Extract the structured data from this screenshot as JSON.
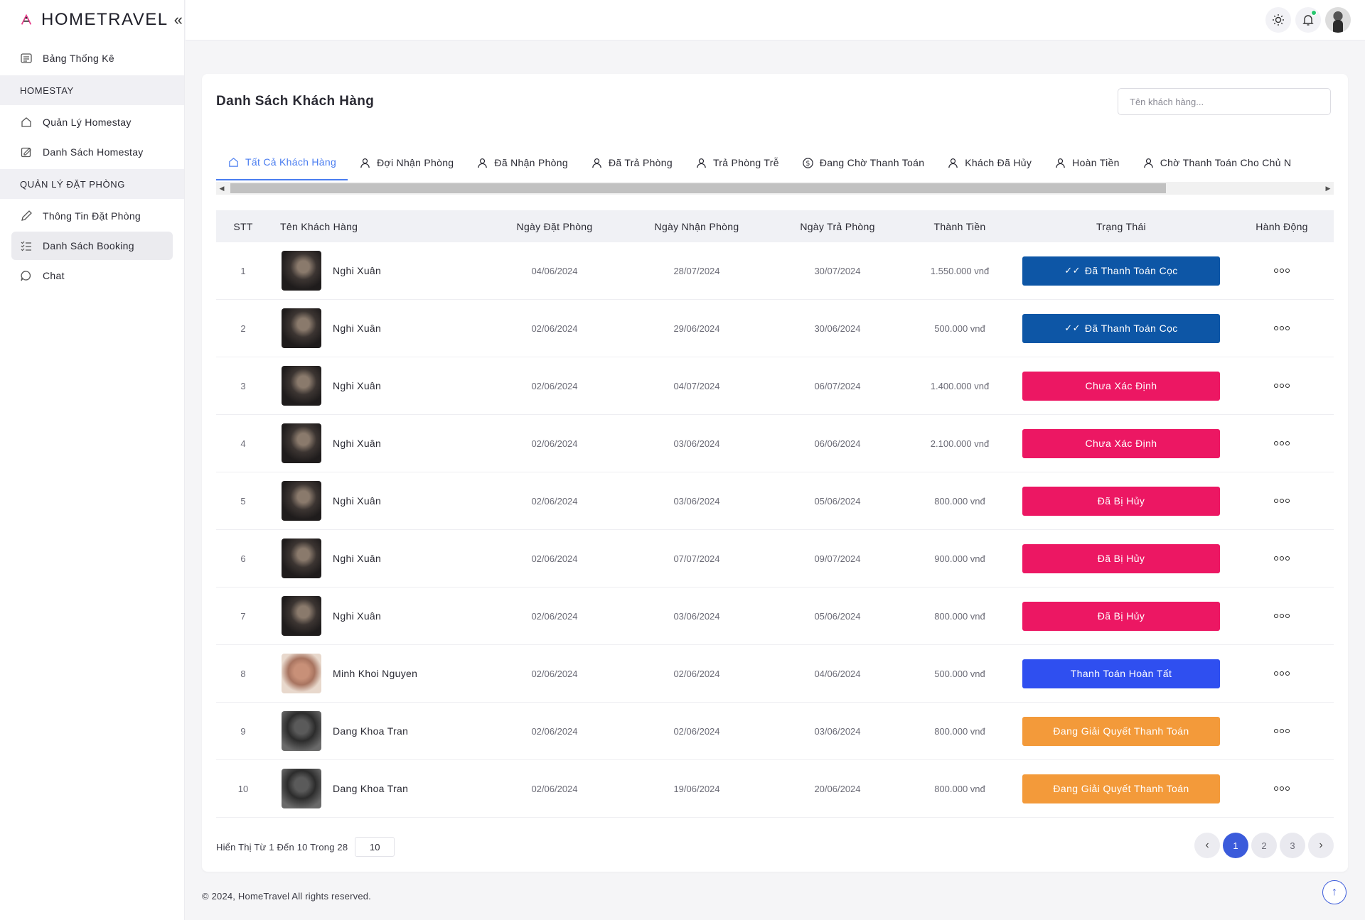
{
  "brand": {
    "name": "HOMETRAVEL",
    "collapse_icon": "chevrons-left-icon"
  },
  "sidebar": {
    "dashboard": {
      "label": "Bảng Thống Kê",
      "icon": "list-icon"
    },
    "section_homestay": "HOMESTAY",
    "homestay_items": [
      {
        "label": "Quản Lý Homestay",
        "icon": "home-icon"
      },
      {
        "label": "Danh Sách Homestay",
        "icon": "edit-square-icon"
      }
    ],
    "section_booking": "QUẢN LÝ ĐẶT PHÒNG",
    "booking_items": [
      {
        "label": "Thông Tin Đặt Phòng",
        "icon": "pencil-icon"
      },
      {
        "label": "Danh Sách Booking",
        "icon": "checklist-icon",
        "active": true
      },
      {
        "label": "Chat",
        "icon": "chat-icon"
      }
    ]
  },
  "topbar": {
    "theme_icon": "sun-icon",
    "notification_icon": "bell-icon",
    "notification_dot_color": "#28c76f"
  },
  "card": {
    "title": "Danh Sách Khách Hàng",
    "search_placeholder": "Tên khách hàng..."
  },
  "tabs": [
    {
      "label": "Tất Cả Khách Hàng",
      "icon": "home-icon",
      "active": true
    },
    {
      "label": "Đợi Nhận Phòng",
      "icon": "user-icon"
    },
    {
      "label": "Đã Nhận Phòng",
      "icon": "user-icon"
    },
    {
      "label": "Đã Trả Phòng",
      "icon": "user-icon"
    },
    {
      "label": "Trả Phòng Trễ",
      "icon": "user-icon"
    },
    {
      "label": "Đang Chờ Thanh Toán",
      "icon": "dollar-circle-icon"
    },
    {
      "label": "Khách Đã Hủy",
      "icon": "user-icon"
    },
    {
      "label": "Hoàn Tiền",
      "icon": "user-icon"
    },
    {
      "label": "Chờ Thanh Toán Cho Chủ N",
      "icon": "user-icon"
    }
  ],
  "table": {
    "headers": [
      "STT",
      "Tên Khách Hàng",
      "Ngày Đặt Phòng",
      "Ngày Nhận Phòng",
      "Ngày Trả Phòng",
      "Thành Tiền",
      "Trạng Thái",
      "Hành Động"
    ],
    "rows": [
      {
        "stt": "1",
        "name": "Nghi Xuân",
        "avatar": "av-1",
        "booked": "04/06/2024",
        "checkin": "28/07/2024",
        "checkout": "30/07/2024",
        "amount": "1.550.000 vnđ",
        "status": "Đã Thanh Toán Cọc",
        "status_color": "#0d56a6",
        "check": true
      },
      {
        "stt": "2",
        "name": "Nghi Xuân",
        "avatar": "av-1",
        "booked": "02/06/2024",
        "checkin": "29/06/2024",
        "checkout": "30/06/2024",
        "amount": "500.000 vnđ",
        "status": "Đã Thanh Toán Cọc",
        "status_color": "#0d56a6",
        "check": true
      },
      {
        "stt": "3",
        "name": "Nghi Xuân",
        "avatar": "av-1",
        "booked": "02/06/2024",
        "checkin": "04/07/2024",
        "checkout": "06/07/2024",
        "amount": "1.400.000 vnđ",
        "status": "Chưa Xác Định",
        "status_color": "#ec1763",
        "check": false
      },
      {
        "stt": "4",
        "name": "Nghi Xuân",
        "avatar": "av-1",
        "booked": "02/06/2024",
        "checkin": "03/06/2024",
        "checkout": "06/06/2024",
        "amount": "2.100.000 vnđ",
        "status": "Chưa Xác Định",
        "status_color": "#ec1763",
        "check": false
      },
      {
        "stt": "5",
        "name": "Nghi Xuân",
        "avatar": "av-1",
        "booked": "02/06/2024",
        "checkin": "03/06/2024",
        "checkout": "05/06/2024",
        "amount": "800.000 vnđ",
        "status": "Đã Bị Hủy",
        "status_color": "#ec1763",
        "check": false
      },
      {
        "stt": "6",
        "name": "Nghi Xuân",
        "avatar": "av-1",
        "booked": "02/06/2024",
        "checkin": "07/07/2024",
        "checkout": "09/07/2024",
        "amount": "900.000 vnđ",
        "status": "Đã Bị Hủy",
        "status_color": "#ec1763",
        "check": false
      },
      {
        "stt": "7",
        "name": "Nghi Xuân",
        "avatar": "av-1",
        "booked": "02/06/2024",
        "checkin": "03/06/2024",
        "checkout": "05/06/2024",
        "amount": "800.000 vnđ",
        "status": "Đã Bị Hủy",
        "status_color": "#ec1763",
        "check": false
      },
      {
        "stt": "8",
        "name": "Minh Khoi Nguyen",
        "avatar": "av-2",
        "booked": "02/06/2024",
        "checkin": "02/06/2024",
        "checkout": "04/06/2024",
        "amount": "500.000 vnđ",
        "status": "Thanh Toán Hoàn Tất",
        "status_color": "#2f4ff0",
        "check": false
      },
      {
        "stt": "9",
        "name": "Dang Khoa Tran",
        "avatar": "av-3",
        "booked": "02/06/2024",
        "checkin": "02/06/2024",
        "checkout": "03/06/2024",
        "amount": "800.000 vnđ",
        "status": "Đang Giải Quyết Thanh Toán",
        "status_color": "#f39a3a",
        "check": false
      },
      {
        "stt": "10",
        "name": "Dang Khoa Tran",
        "avatar": "av-3",
        "booked": "02/06/2024",
        "checkin": "19/06/2024",
        "checkout": "20/06/2024",
        "amount": "800.000 vnđ",
        "status": "Đang Giải Quyết Thanh Toán",
        "status_color": "#f39a3a",
        "check": false
      }
    ]
  },
  "footer": {
    "showing": "Hiển Thị Từ 1 Đến 10 Trong 28",
    "page_size": "10",
    "pages": [
      "1",
      "2",
      "3"
    ],
    "current_page": "1",
    "prev": "‹",
    "next": "›",
    "copyright": "© 2024, HomeTravel All rights reserved.",
    "to_top": "↑"
  }
}
